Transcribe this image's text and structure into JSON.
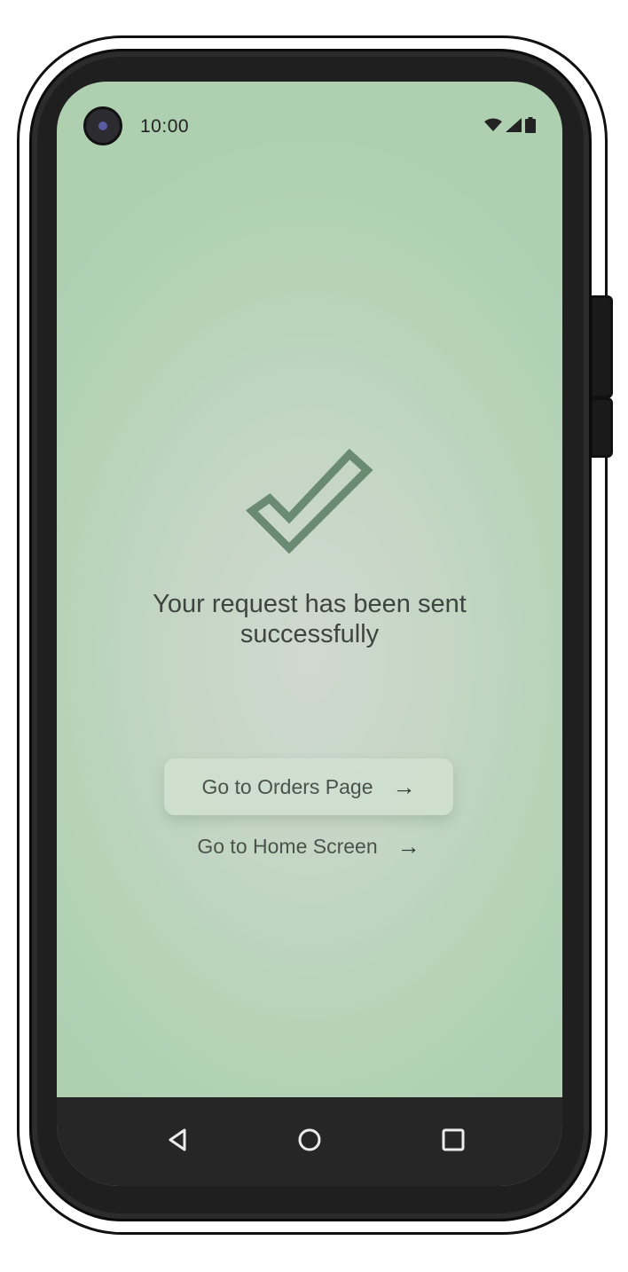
{
  "status_bar": {
    "time": "10:00",
    "icons": [
      "wifi-icon",
      "signal-icon",
      "battery-icon"
    ]
  },
  "confirmation": {
    "icon": "checkmark-icon",
    "message": "Your request has been sent successfully"
  },
  "actions": {
    "orders_label": "Go to Orders Page",
    "home_label": "Go to Home Screen",
    "arrow": "→"
  },
  "nav_bar": {
    "buttons": [
      "back-icon",
      "home-icon",
      "recents-icon"
    ]
  },
  "colors": {
    "screen_background": "#b6d3b8",
    "checkmark": "#6b8a72",
    "text": "#3e4440",
    "nav_bar": "#262626"
  }
}
